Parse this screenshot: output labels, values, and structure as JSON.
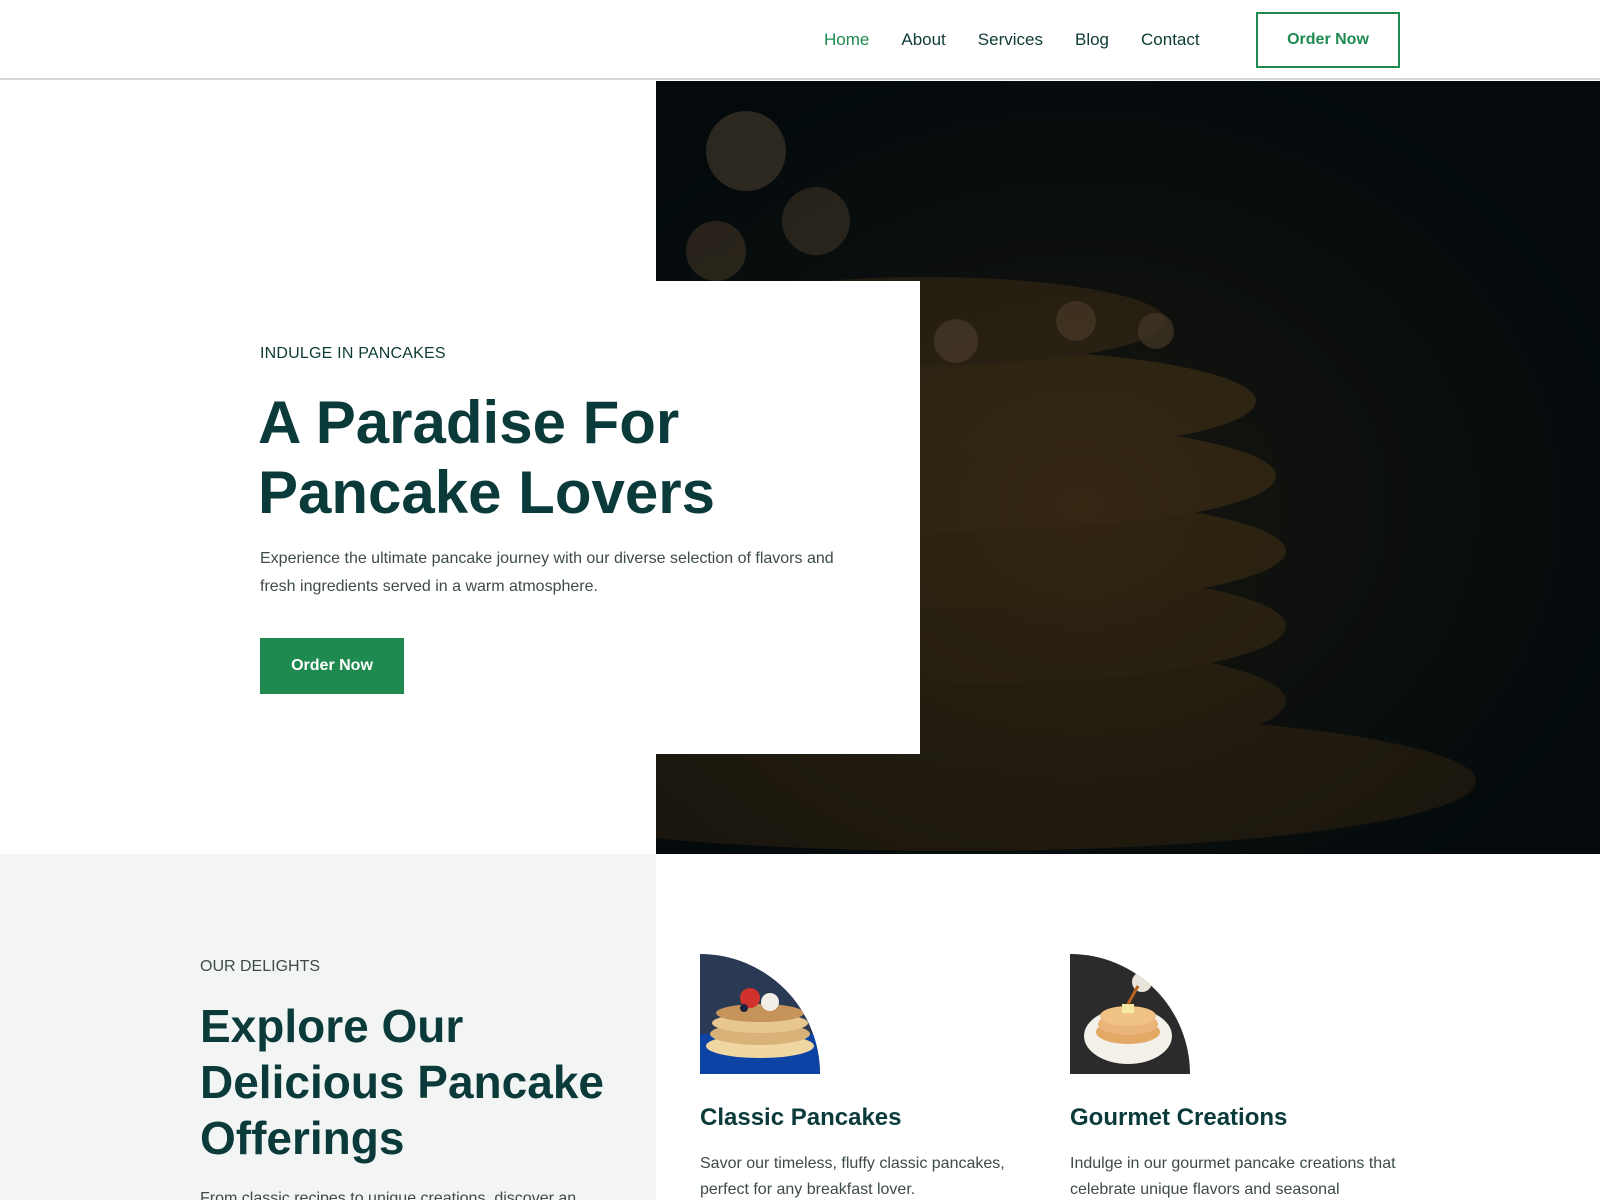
{
  "colors": {
    "accent": "#1e8a4f",
    "heading": "#0b3a3a",
    "text": "#3d4b4a",
    "soft_bg": "#f2f5f4"
  },
  "header": {
    "nav": [
      "Home",
      "About",
      "Services",
      "Blog",
      "Contact"
    ],
    "cta": "Order Now"
  },
  "hero": {
    "eyebrow": "INDULGE IN PANCAKES",
    "title_line1": "A Paradise For",
    "title_line2": "Pancake Lovers",
    "description": "Experience the ultimate pancake journey with our diverse selection of flavors and fresh ingredients served in a warm atmosphere.",
    "cta": "Order Now"
  },
  "offerings": {
    "eyebrow": "OUR DELIGHTS",
    "title_line1": "Explore Our",
    "title_line2": "Delicious Pancake",
    "title_line3": "Offerings",
    "description": "From classic recipes to unique creations, discover an",
    "cards": [
      {
        "title": "Classic Pancakes",
        "description": "Savor our timeless, fluffy classic pancakes, perfect for any breakfast lover."
      },
      {
        "title": "Gourmet Creations",
        "description": "Indulge in our gourmet pancake creations that celebrate unique flavors and seasonal"
      }
    ]
  }
}
